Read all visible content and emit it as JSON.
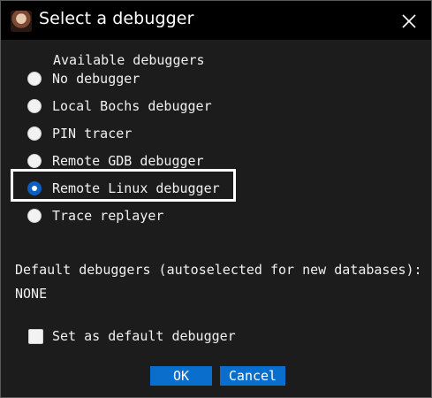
{
  "window": {
    "title": "Select a debugger",
    "app_icon": "avatar-icon",
    "close_icon": "close-icon"
  },
  "group": {
    "label": "Available debuggers"
  },
  "debuggers": [
    {
      "label": "No debugger",
      "checked": false
    },
    {
      "label": "Local Bochs debugger",
      "checked": false
    },
    {
      "label": "PIN tracer",
      "checked": false
    },
    {
      "label": "Remote GDB debugger",
      "checked": false
    },
    {
      "label": "Remote Linux debugger",
      "checked": true
    },
    {
      "label": "Trace replayer",
      "checked": false
    }
  ],
  "defaults": {
    "label": "Default debuggers (autoselected for new databases):",
    "value": "NONE"
  },
  "set_default": {
    "label": "Set as default debugger",
    "checked": false
  },
  "buttons": {
    "ok": "OK",
    "cancel": "Cancel"
  },
  "colors": {
    "accent": "#0a6fcc",
    "background": "#1c1c1c",
    "titlebar": "#000000"
  }
}
